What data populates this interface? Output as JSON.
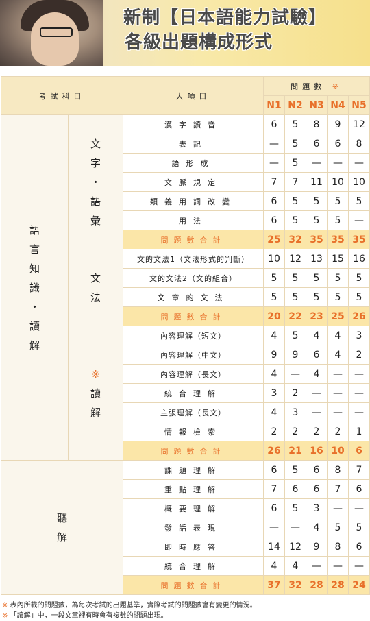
{
  "header": {
    "title_line1": "新制【日本語能力試驗】",
    "title_line2": "各級出題構成形式"
  },
  "table": {
    "col_subject": "考試科目",
    "col_item": "大項目",
    "col_count": "問題數",
    "col_count_mark": "※",
    "levels": [
      "N1",
      "N2",
      "N3",
      "N4",
      "N5"
    ],
    "section_language": "語言知識・讀解",
    "sub_vocab": "文字・語彙",
    "sub_grammar": "文法",
    "sub_reading_mark": "※",
    "sub_reading": "讀解",
    "section_listening": "聽解",
    "sum_label": "問題數合計",
    "vocab_rows": [
      {
        "label": "漢字讀音",
        "values": [
          "6",
          "5",
          "8",
          "9",
          "12"
        ]
      },
      {
        "label": "表記",
        "values": [
          "—",
          "5",
          "6",
          "6",
          "8"
        ]
      },
      {
        "label": "語形成",
        "values": [
          "—",
          "5",
          "—",
          "—",
          "—"
        ]
      },
      {
        "label": "文脈規定",
        "values": [
          "7",
          "7",
          "11",
          "10",
          "10"
        ]
      },
      {
        "label": "類義用詞改變",
        "values": [
          "6",
          "5",
          "5",
          "5",
          "5"
        ]
      },
      {
        "label": "用法",
        "values": [
          "6",
          "5",
          "5",
          "5",
          "—"
        ]
      }
    ],
    "vocab_sum": [
      "25",
      "32",
      "35",
      "35",
      "35"
    ],
    "grammar_rows": [
      {
        "label": "文的文法1（文法形式的判斷）",
        "values": [
          "10",
          "12",
          "13",
          "15",
          "16"
        ]
      },
      {
        "label": "文的文法2（文的組合）",
        "values": [
          "5",
          "5",
          "5",
          "5",
          "5"
        ]
      },
      {
        "label": "文章的文法",
        "values": [
          "5",
          "5",
          "5",
          "5",
          "5"
        ]
      }
    ],
    "grammar_sum": [
      "20",
      "22",
      "23",
      "25",
      "26"
    ],
    "reading_rows": [
      {
        "label": "內容理解（短文）",
        "values": [
          "4",
          "5",
          "4",
          "4",
          "3"
        ]
      },
      {
        "label": "內容理解（中文）",
        "values": [
          "9",
          "9",
          "6",
          "4",
          "2"
        ]
      },
      {
        "label": "內容理解（長文）",
        "values": [
          "4",
          "—",
          "4",
          "—",
          "—"
        ]
      },
      {
        "label": "統合理解",
        "values": [
          "3",
          "2",
          "—",
          "—",
          "—"
        ]
      },
      {
        "label": "主張理解（長文）",
        "values": [
          "4",
          "3",
          "—",
          "—",
          "—"
        ]
      },
      {
        "label": "情報檢索",
        "values": [
          "2",
          "2",
          "2",
          "2",
          "1"
        ]
      }
    ],
    "reading_sum": [
      "26",
      "21",
      "16",
      "10",
      "6"
    ],
    "listening_rows": [
      {
        "label": "課題理解",
        "values": [
          "6",
          "5",
          "6",
          "8",
          "7"
        ]
      },
      {
        "label": "重點理解",
        "values": [
          "7",
          "6",
          "6",
          "7",
          "6"
        ]
      },
      {
        "label": "概要理解",
        "values": [
          "6",
          "5",
          "3",
          "—",
          "—"
        ]
      },
      {
        "label": "發話表現",
        "values": [
          "—",
          "—",
          "4",
          "5",
          "5"
        ]
      },
      {
        "label": "即時應答",
        "values": [
          "14",
          "12",
          "9",
          "8",
          "6"
        ]
      },
      {
        "label": "統合理解",
        "values": [
          "4",
          "4",
          "—",
          "—",
          "—"
        ]
      }
    ],
    "listening_sum": [
      "37",
      "32",
      "28",
      "28",
      "24"
    ]
  },
  "notes": {
    "mark": "※",
    "note1": "表內所載的問題數，為每次考試的出題基準，實際考試的問題數會有變更的情況。",
    "note2": "「讀解」中，一段文章裡有時會有複數的問題出現。"
  }
}
